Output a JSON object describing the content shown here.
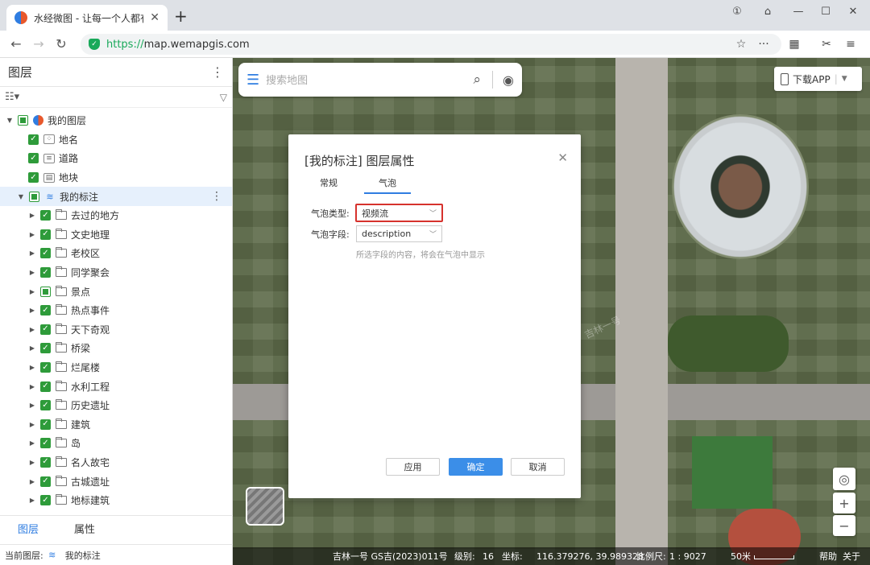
{
  "browser": {
    "tab_title": "水经微图 - 让每一个人都有自",
    "url_protocol": "https://",
    "url_host": "map.wemapgis.com"
  },
  "left_panel": {
    "title": "图层",
    "tree": [
      {
        "label": "我的图层",
        "icon": "globe-icon",
        "level": 0
      },
      {
        "label": "地名",
        "icon": "place-name-icon",
        "level": 1
      },
      {
        "label": "道路",
        "icon": "road-icon",
        "level": 1
      },
      {
        "label": "地块",
        "icon": "parcel-icon",
        "level": 1
      },
      {
        "label": "我的标注",
        "icon": "layers-icon",
        "level": 1
      },
      {
        "label": "去过的地方",
        "icon": "folder-icon",
        "level": 2
      },
      {
        "label": "文史地理",
        "icon": "folder-icon",
        "level": 2
      },
      {
        "label": "老校区",
        "icon": "folder-icon",
        "level": 2
      },
      {
        "label": "同学聚会",
        "icon": "folder-icon",
        "level": 2
      },
      {
        "label": "景点",
        "icon": "folder-icon",
        "level": 2
      },
      {
        "label": "热点事件",
        "icon": "folder-icon",
        "level": 2
      },
      {
        "label": "天下奇观",
        "icon": "folder-icon",
        "level": 2
      },
      {
        "label": "桥梁",
        "icon": "folder-icon",
        "level": 2
      },
      {
        "label": "烂尾楼",
        "icon": "folder-icon",
        "level": 2
      },
      {
        "label": "水利工程",
        "icon": "folder-icon",
        "level": 2
      },
      {
        "label": "历史遗址",
        "icon": "folder-icon",
        "level": 2
      },
      {
        "label": "建筑",
        "icon": "folder-icon",
        "level": 2
      },
      {
        "label": "岛",
        "icon": "folder-icon",
        "level": 2
      },
      {
        "label": "名人故宅",
        "icon": "folder-icon",
        "level": 2
      },
      {
        "label": "古城遗址",
        "icon": "folder-icon",
        "level": 2
      },
      {
        "label": "地标建筑",
        "icon": "folder-icon",
        "level": 2
      }
    ],
    "tabs": [
      "图层",
      "属性"
    ],
    "status_label": "当前图层:",
    "status_value": "我的标注"
  },
  "map": {
    "search_placeholder": "搜索地图",
    "download_app": "下载APP",
    "watermark": "吉林一号",
    "status": {
      "source": "吉林一号 GS吉(2023)011号",
      "level_label": "级别:",
      "level": "16",
      "coord_label": "坐标:",
      "coord": "116.379276, 39.989328",
      "scale_label": "比例尺:",
      "scale": "1 : 9027",
      "scalebar": "50米",
      "help": "帮助",
      "about": "关于"
    }
  },
  "dialog": {
    "title": "[我的标注] 图层属性",
    "tabs": [
      "常规",
      "气泡"
    ],
    "bubble_type_label": "气泡类型:",
    "bubble_type_value": "视频流",
    "bubble_field_label": "气泡字段:",
    "bubble_field_value": "description",
    "hint": "所选字段的内容，将会在气泡中显示",
    "apply": "应用",
    "ok": "确定",
    "cancel": "取消"
  },
  "colors": {
    "accent": "#2f7de1",
    "check_green": "#2e9b3a",
    "highlight_red": "#d6322d"
  }
}
